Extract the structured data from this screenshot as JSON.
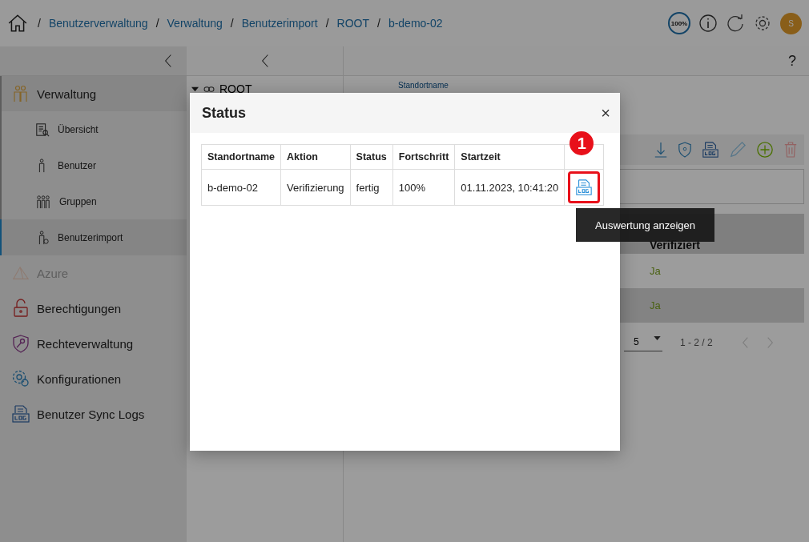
{
  "breadcrumb": [
    {
      "separator": "/",
      "label": "Benutzerverwaltung"
    },
    {
      "separator": "/",
      "label": "Verwaltung"
    },
    {
      "separator": "/",
      "label": "Benutzerimport"
    },
    {
      "separator": "/",
      "label": "ROOT"
    },
    {
      "separator": "/",
      "label": "b-demo-02"
    }
  ],
  "header": {
    "zoom_badge": "100%",
    "avatar": "S"
  },
  "sidebar": {
    "items": [
      {
        "label": "Verwaltung",
        "expanded": true,
        "disabled": false,
        "children": [
          {
            "label": "Übersicht",
            "selected": false
          },
          {
            "label": "Benutzer",
            "selected": false
          },
          {
            "label": "Gruppen",
            "selected": false
          },
          {
            "label": "Benutzerimport",
            "selected": true
          }
        ]
      },
      {
        "label": "Azure",
        "expanded": false,
        "disabled": true
      },
      {
        "label": "Berechtigungen",
        "expanded": false,
        "disabled": false
      },
      {
        "label": "Rechteverwaltung",
        "expanded": false,
        "disabled": false
      },
      {
        "label": "Konfigurationen",
        "expanded": false,
        "disabled": false
      },
      {
        "label": "Benutzer Sync Logs",
        "expanded": false,
        "disabled": false
      }
    ]
  },
  "tree": {
    "label": "ROOT",
    "expanded": true
  },
  "help": "?",
  "detail": {
    "field_label": "Standortname",
    "table_header": "Verifiziert",
    "rows": [
      "Ja",
      "Ja"
    ],
    "page_size": "5",
    "range": "1 - 2 / 2"
  },
  "dialog": {
    "title": "Status",
    "close": "×",
    "columns": [
      "Standortname",
      "Aktion",
      "Status",
      "Fortschritt",
      "Startzeit"
    ],
    "rows": [
      [
        "b-demo-02",
        "Verifizierung",
        "fertig",
        "100%",
        "01.11.2023, 10:41:20"
      ]
    ],
    "step_badge": "1",
    "tooltip": "Auswertung anzeigen"
  }
}
